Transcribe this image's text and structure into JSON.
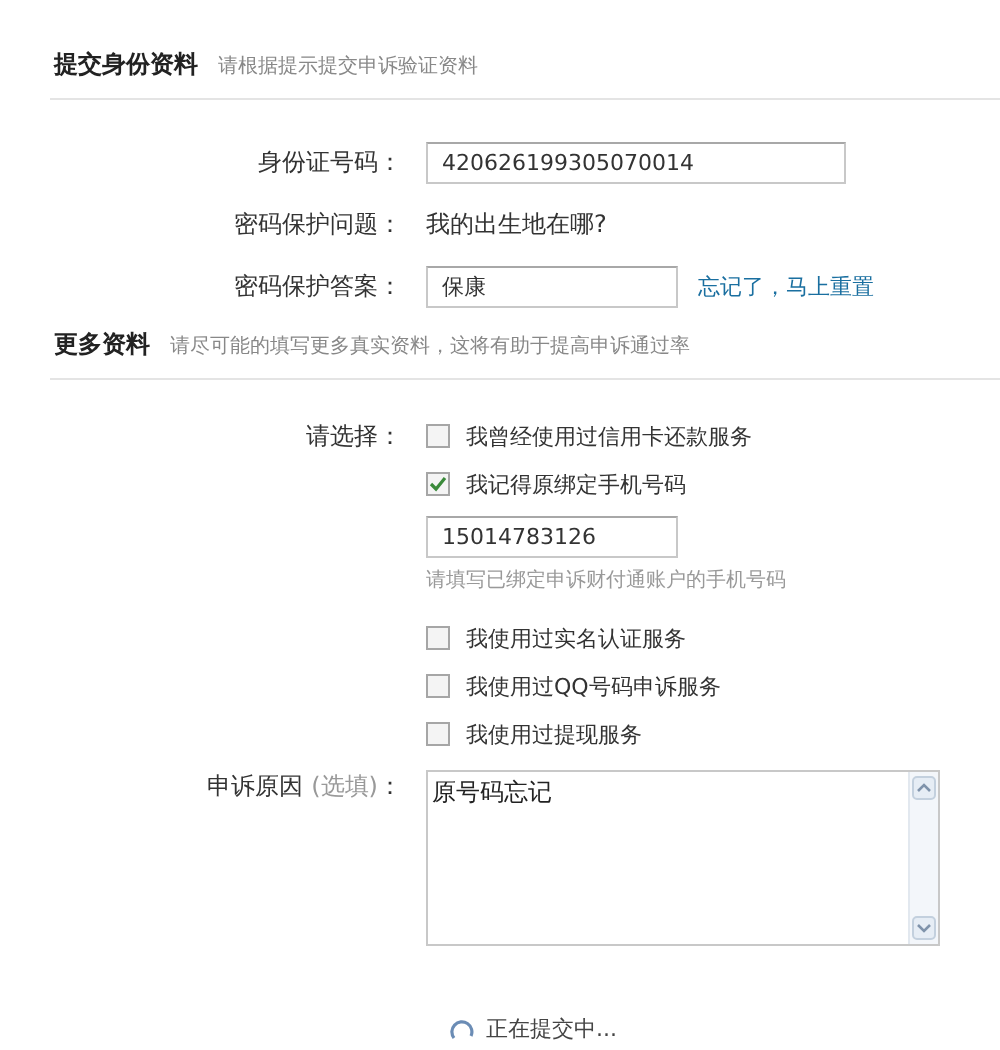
{
  "sections": [
    {
      "title": "提交身份资料",
      "subtitle": "请根据提示提交申诉验证资料"
    },
    {
      "title": "更多资料",
      "subtitle": "请尽可能的填写更多真实资料，这将有助于提高申诉通过率"
    }
  ],
  "identity": {
    "id_label": "身份证号码：",
    "id_value": "420626199305070014",
    "question_label": "密码保护问题：",
    "question": "我的出生地在哪?",
    "answer_label": "密码保护答案：",
    "answer_value": "保康",
    "reset_link": "忘记了，马上重置"
  },
  "choose_label": "请选择：",
  "options": [
    {
      "kind": "checkbox",
      "label": "我曾经使用过信用卡还款服务",
      "checked": false
    },
    {
      "kind": "checkbox",
      "label": "我记得原绑定手机号码",
      "checked": true,
      "field_value": "15014783126",
      "hint": "请填写已绑定申诉财付通账户的手机号码"
    },
    {
      "kind": "checkbox",
      "label": "我使用过实名认证服务",
      "checked": false
    },
    {
      "kind": "checkbox",
      "label": "我使用过QQ号码申诉服务",
      "checked": false
    },
    {
      "kind": "checkbox",
      "label": "我使用过提现服务",
      "checked": false
    }
  ],
  "reason": {
    "label": "申诉原因",
    "note": "(选填)",
    "colon": "：",
    "value": "原号码忘记"
  },
  "status": "正在提交中..."
}
